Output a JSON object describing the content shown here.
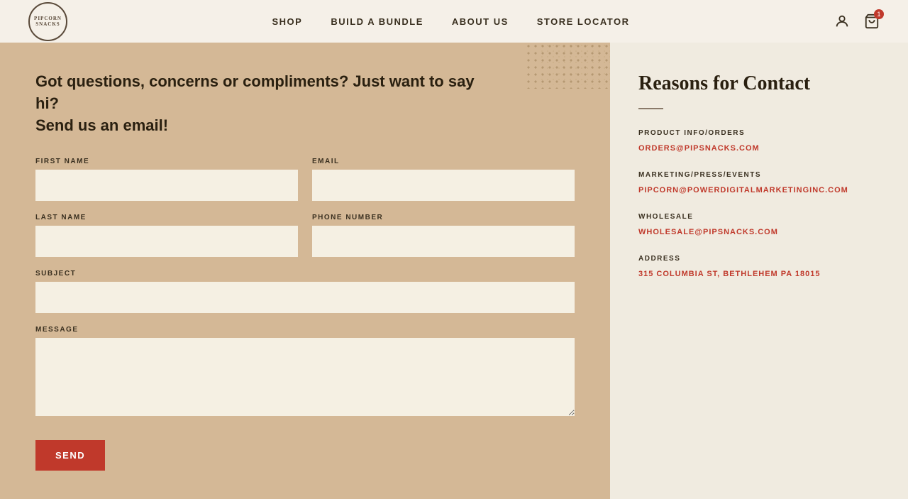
{
  "header": {
    "logo": {
      "line1": "PIPCORN",
      "line2": "SNACKS"
    },
    "nav": {
      "items": [
        {
          "label": "SHOP",
          "id": "shop"
        },
        {
          "label": "BUILD A BUNDLE",
          "id": "bundle"
        },
        {
          "label": "ABOUT US",
          "id": "about"
        },
        {
          "label": "STORE LOCATOR",
          "id": "locator"
        }
      ]
    },
    "cart_count": "1"
  },
  "contact": {
    "heading_line1": "Got questions, concerns or compliments? Just want to say hi?",
    "heading_line2": "Send us an email!",
    "fields": {
      "first_name_label": "FIRST NAME",
      "email_label": "EMAIL",
      "last_name_label": "LAST NAME",
      "phone_label": "PHONE NUMBER",
      "subject_label": "SUBJECT",
      "message_label": "MESSAGE"
    },
    "send_button": "SEND"
  },
  "reasons": {
    "heading": "Reasons for Contact",
    "divider": true,
    "items": [
      {
        "category": "PRODUCT INFO/ORDERS",
        "email": "ORDERS@PIPSNACKS.COM"
      },
      {
        "category": "MARKETING/PRESS/EVENTS",
        "email": "PIPCORN@POWERDIGITALMARKETINGINC.COM"
      },
      {
        "category": "WHOLESALE",
        "email": "WHOLESALE@PIPSNACKS.COM"
      },
      {
        "category": "ADDRESS",
        "email": "315 COLUMBIA ST, BETHLEHEM PA 18015"
      }
    ]
  }
}
